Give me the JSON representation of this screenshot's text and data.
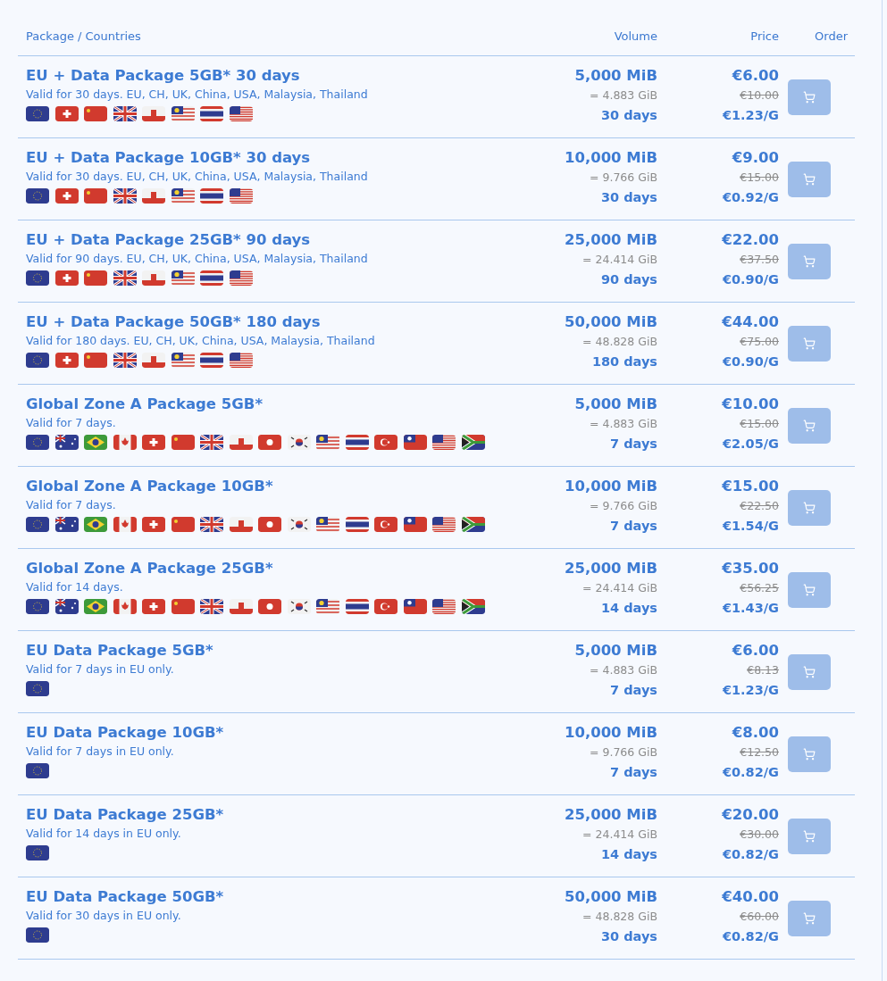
{
  "table": {
    "columns": [
      "Package / Countries",
      "Volume",
      "Price",
      "Order"
    ],
    "rows": [
      {
        "name": "EU + Data Package 5GB* 30 days",
        "description": "Valid for 30 days. EU, CH, UK, China, USA, Malaysia, Thailand",
        "flags": [
          {
            "kind": "eu"
          },
          {
            "kind": "ch"
          },
          {
            "kind": "cn"
          },
          {
            "kind": "gb"
          },
          {
            "kind": "gi"
          },
          {
            "kind": "my"
          },
          {
            "kind": "th"
          },
          {
            "kind": "us"
          }
        ],
        "volume": "5,000 MiB",
        "volume_gib": "= 4.883 GiB",
        "duration": "30 days",
        "price": "€6.00",
        "old_price": "€10.00",
        "unit_price": "€1.23/G"
      },
      {
        "name": "EU + Data Package 10GB* 30 days",
        "description": "Valid for 30 days. EU, CH, UK, China, USA, Malaysia, Thailand",
        "flags": [
          {
            "kind": "eu"
          },
          {
            "kind": "ch"
          },
          {
            "kind": "cn"
          },
          {
            "kind": "gb"
          },
          {
            "kind": "gi"
          },
          {
            "kind": "my"
          },
          {
            "kind": "th"
          },
          {
            "kind": "us"
          }
        ],
        "volume": "10,000 MiB",
        "volume_gib": "= 9.766 GiB",
        "duration": "30 days",
        "price": "€9.00",
        "old_price": "€15.00",
        "unit_price": "€0.92/G"
      },
      {
        "name": "EU + Data Package 25GB* 90 days",
        "description": "Valid for 90 days. EU, CH, UK, China, USA, Malaysia, Thailand",
        "flags": [
          {
            "kind": "eu"
          },
          {
            "kind": "ch"
          },
          {
            "kind": "cn"
          },
          {
            "kind": "gb"
          },
          {
            "kind": "gi"
          },
          {
            "kind": "my"
          },
          {
            "kind": "th"
          },
          {
            "kind": "us"
          }
        ],
        "volume": "25,000 MiB",
        "volume_gib": "= 24.414 GiB",
        "duration": "90 days",
        "price": "€22.00",
        "old_price": "€37.50",
        "unit_price": "€0.90/G"
      },
      {
        "name": "EU + Data Package 50GB* 180 days",
        "description": "Valid for 180 days. EU, CH, UK, China, USA, Malaysia, Thailand",
        "flags": [
          {
            "kind": "eu"
          },
          {
            "kind": "ch"
          },
          {
            "kind": "cn"
          },
          {
            "kind": "gb"
          },
          {
            "kind": "gi"
          },
          {
            "kind": "my"
          },
          {
            "kind": "th"
          },
          {
            "kind": "us"
          }
        ],
        "volume": "50,000 MiB",
        "volume_gib": "= 48.828 GiB",
        "duration": "180 days",
        "price": "€44.00",
        "old_price": "€75.00",
        "unit_price": "€0.90/G"
      },
      {
        "name": "Global Zone A Package 5GB*",
        "description": "Valid for 7 days.",
        "flags": [
          {
            "kind": "eu"
          },
          {
            "kind": "au"
          },
          {
            "kind": "br"
          },
          {
            "kind": "ca"
          },
          {
            "kind": "ch"
          },
          {
            "kind": "cn"
          },
          {
            "kind": "gb"
          },
          {
            "kind": "gi"
          },
          {
            "kind": "hk"
          },
          {
            "kind": "kr"
          },
          {
            "kind": "my"
          },
          {
            "kind": "th"
          },
          {
            "kind": "tr"
          },
          {
            "kind": "tw"
          },
          {
            "kind": "us"
          },
          {
            "kind": "za"
          }
        ],
        "volume": "5,000 MiB",
        "volume_gib": "= 4.883 GiB",
        "duration": "7 days",
        "price": "€10.00",
        "old_price": "€15.00",
        "unit_price": "€2.05/G"
      },
      {
        "name": "Global Zone A Package 10GB*",
        "description": "Valid for 7 days.",
        "flags": [
          {
            "kind": "eu"
          },
          {
            "kind": "au"
          },
          {
            "kind": "br"
          },
          {
            "kind": "ca"
          },
          {
            "kind": "ch"
          },
          {
            "kind": "cn"
          },
          {
            "kind": "gb"
          },
          {
            "kind": "gi"
          },
          {
            "kind": "hk"
          },
          {
            "kind": "kr"
          },
          {
            "kind": "my"
          },
          {
            "kind": "th"
          },
          {
            "kind": "tr"
          },
          {
            "kind": "tw"
          },
          {
            "kind": "us"
          },
          {
            "kind": "za"
          }
        ],
        "volume": "10,000 MiB",
        "volume_gib": "= 9.766 GiB",
        "duration": "7 days",
        "price": "€15.00",
        "old_price": "€22.50",
        "unit_price": "€1.54/G"
      },
      {
        "name": "Global Zone A Package 25GB*",
        "description": "Valid for 14 days.",
        "flags": [
          {
            "kind": "eu"
          },
          {
            "kind": "au"
          },
          {
            "kind": "br"
          },
          {
            "kind": "ca"
          },
          {
            "kind": "ch"
          },
          {
            "kind": "cn"
          },
          {
            "kind": "gb"
          },
          {
            "kind": "gi"
          },
          {
            "kind": "hk"
          },
          {
            "kind": "kr"
          },
          {
            "kind": "my"
          },
          {
            "kind": "th"
          },
          {
            "kind": "tr"
          },
          {
            "kind": "tw"
          },
          {
            "kind": "us"
          },
          {
            "kind": "za"
          }
        ],
        "volume": "25,000 MiB",
        "volume_gib": "= 24.414 GiB",
        "duration": "14 days",
        "price": "€35.00",
        "old_price": "€56.25",
        "unit_price": "€1.43/G"
      },
      {
        "name": "EU Data Package 5GB*",
        "description": "Valid for 7 days in EU only.",
        "flags": [
          {
            "kind": "eu"
          }
        ],
        "volume": "5,000 MiB",
        "volume_gib": "= 4.883 GiB",
        "duration": "7 days",
        "price": "€6.00",
        "old_price": "€8.13",
        "unit_price": "€1.23/G"
      },
      {
        "name": "EU Data Package 10GB*",
        "description": "Valid for 7 days in EU only.",
        "flags": [
          {
            "kind": "eu"
          }
        ],
        "volume": "10,000 MiB",
        "volume_gib": "= 9.766 GiB",
        "duration": "7 days",
        "price": "€8.00",
        "old_price": "€12.50",
        "unit_price": "€0.82/G"
      },
      {
        "name": "EU Data Package 25GB*",
        "description": "Valid for 14 days in EU only.",
        "flags": [
          {
            "kind": "eu"
          }
        ],
        "volume": "25,000 MiB",
        "volume_gib": "= 24.414 GiB",
        "duration": "14 days",
        "price": "€20.00",
        "old_price": "€30.00",
        "unit_price": "€0.82/G"
      },
      {
        "name": "EU Data Package 50GB*",
        "description": "Valid for 30 days in EU only.",
        "flags": [
          {
            "kind": "eu"
          }
        ],
        "volume": "50,000 MiB",
        "volume_gib": "= 48.828 GiB",
        "duration": "30 days",
        "price": "€40.00",
        "old_price": "€60.00",
        "unit_price": "€0.82/G"
      }
    ]
  }
}
